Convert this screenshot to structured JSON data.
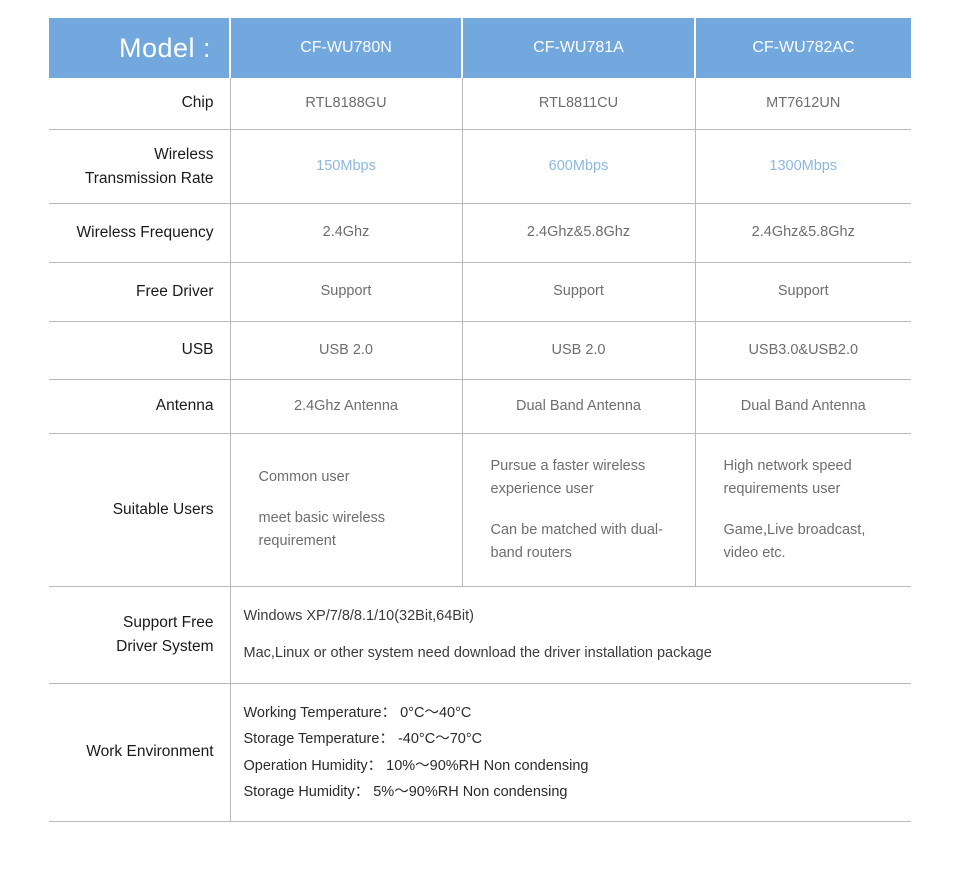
{
  "table": {
    "header": {
      "title": "Model :",
      "models": [
        "CF-WU780N",
        "CF-WU781A",
        "CF-WU782AC"
      ],
      "background_color": "#72a8de",
      "text_color": "#ffffff"
    },
    "accent_rate_color": "#8cb8e0",
    "border_color": "#b8b8b8",
    "rows": [
      {
        "label": "Chip",
        "values": [
          "RTL8188GU",
          "RTL8811CU",
          "MT7612UN"
        ]
      },
      {
        "label_line1": "Wireless",
        "label_line2": "Transmission Rate",
        "values": [
          "150Mbps",
          "600Mbps",
          "1300Mbps"
        ]
      },
      {
        "label": "Wireless Frequency",
        "values": [
          "2.4Ghz",
          "2.4Ghz&5.8Ghz",
          "2.4Ghz&5.8Ghz"
        ]
      },
      {
        "label": "Free Driver",
        "values": [
          "Support",
          "Support",
          "Support"
        ]
      },
      {
        "label": "USB",
        "values": [
          "USB 2.0",
          "USB 2.0",
          "USB3.0&USB2.0"
        ]
      },
      {
        "label": "Antenna",
        "values": [
          "2.4Ghz Antenna",
          "Dual Band Antenna",
          "Dual Band Antenna"
        ]
      },
      {
        "label": "Suitable Users",
        "col1_para1": "Common user",
        "col1_para2": "meet basic wireless requirement",
        "col2_para1": "Pursue a faster wireless experience user",
        "col2_para2": "Can be matched with dual-band routers",
        "col3_para1": "High network speed requirements user",
        "col3_para2": "Game,Live broadcast, video etc."
      },
      {
        "label_line1": "Support Free",
        "label_line2": "Driver System",
        "line1": "Windows XP/7/8/8.1/10(32Bit,64Bit)",
        "line2": "Mac,Linux or other system need download the driver installation package"
      },
      {
        "label": "Work Environment",
        "line1": "Working Temperature： 0°C～40°C",
        "line2": "Storage Temperature： -40°C～70°C",
        "line3": "Operation Humidity： 10%～90%RH Non condensing",
        "line4": "Storage Humidity： 5%～90%RH Non condensing"
      }
    ]
  }
}
